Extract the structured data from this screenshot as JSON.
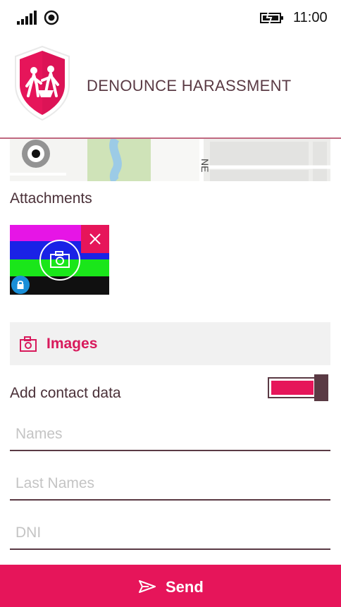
{
  "status_bar": {
    "time": "11:00",
    "icons": [
      "signal-icon",
      "location-icon",
      "battery-icon"
    ]
  },
  "header": {
    "title": "DENOUNCE HARASSMENT",
    "logo_icon": "harassment-shield-logo"
  },
  "attachments": {
    "label": "Attachments",
    "items": [
      {
        "icon": "camera-icon",
        "remove_icon": "close-icon",
        "lock_icon": "lock-icon"
      }
    ]
  },
  "images_button": {
    "label": "Images",
    "icon": "camera-icon"
  },
  "contact": {
    "label": "Add contact data",
    "toggle_on": true
  },
  "fields": {
    "names_placeholder": "Names",
    "last_names_placeholder": "Last Names",
    "dni_placeholder": "DNI"
  },
  "send_button": {
    "label": "Send",
    "icon": "send-icon"
  },
  "colors": {
    "accent": "#e6155a",
    "text": "#5a3a44",
    "muted_bg": "#f1f1f1",
    "info_badge": "#1a8fd8"
  }
}
